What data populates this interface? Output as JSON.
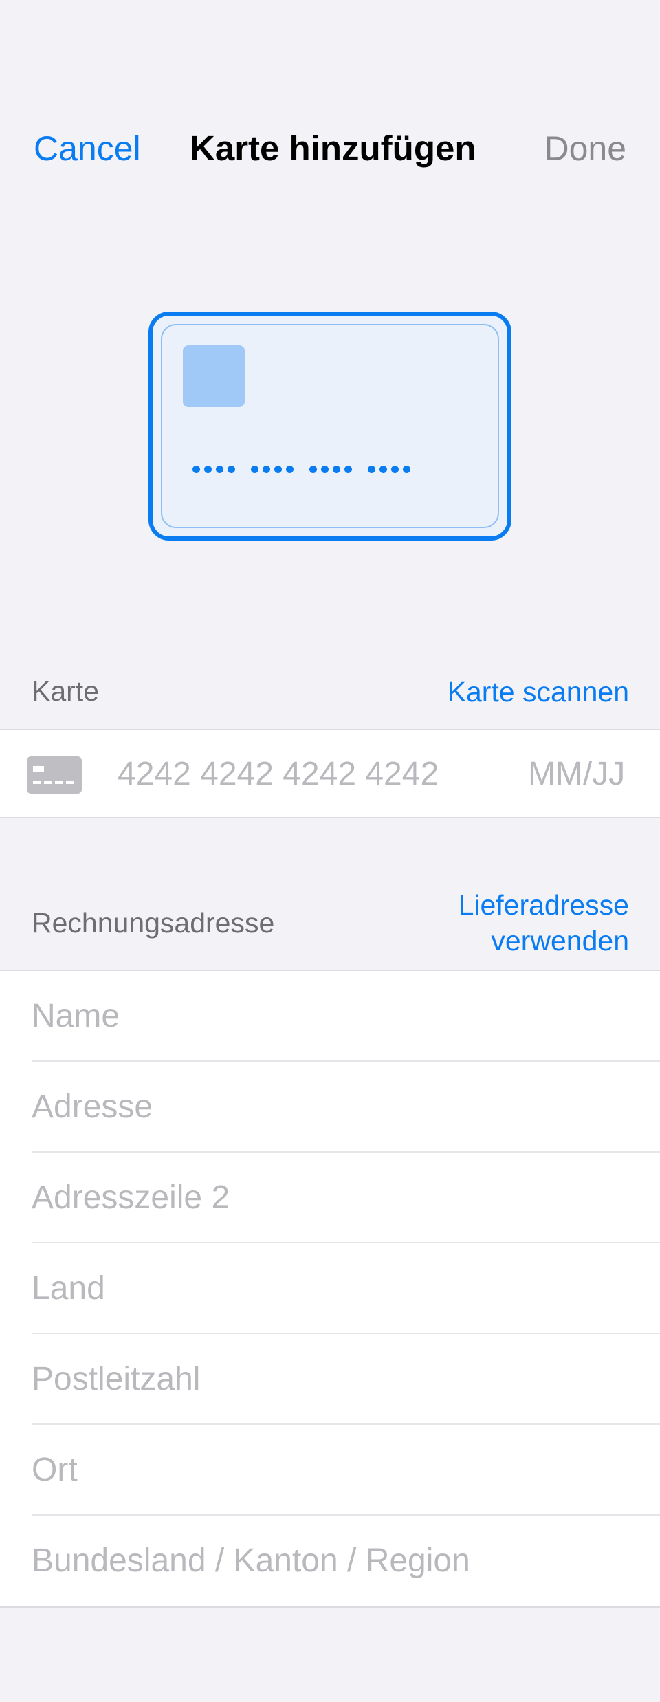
{
  "nav": {
    "cancel_label": "Cancel",
    "title": "Karte hinzufügen",
    "done_label": "Done"
  },
  "card_section": {
    "title": "Karte",
    "action_label": "Karte scannen",
    "number_placeholder": "4242 4242 4242 4242",
    "expiry_placeholder": "MM/JJ"
  },
  "billing_section": {
    "title": "Rechnungsadresse",
    "action_line1": "Lieferadresse",
    "action_line2": "verwenden",
    "fields": [
      {
        "placeholder": "Name"
      },
      {
        "placeholder": "Adresse"
      },
      {
        "placeholder": "Adresszeile 2"
      },
      {
        "placeholder": "Land"
      },
      {
        "placeholder": "Postleitzahl"
      },
      {
        "placeholder": "Ort"
      },
      {
        "placeholder": "Bundesland / Kanton / Region"
      }
    ]
  },
  "colors": {
    "accent": "#0a7cf2",
    "background": "#f2f2f7",
    "placeholder": "#b8b8bd",
    "secondary_text": "#6d6d72"
  }
}
